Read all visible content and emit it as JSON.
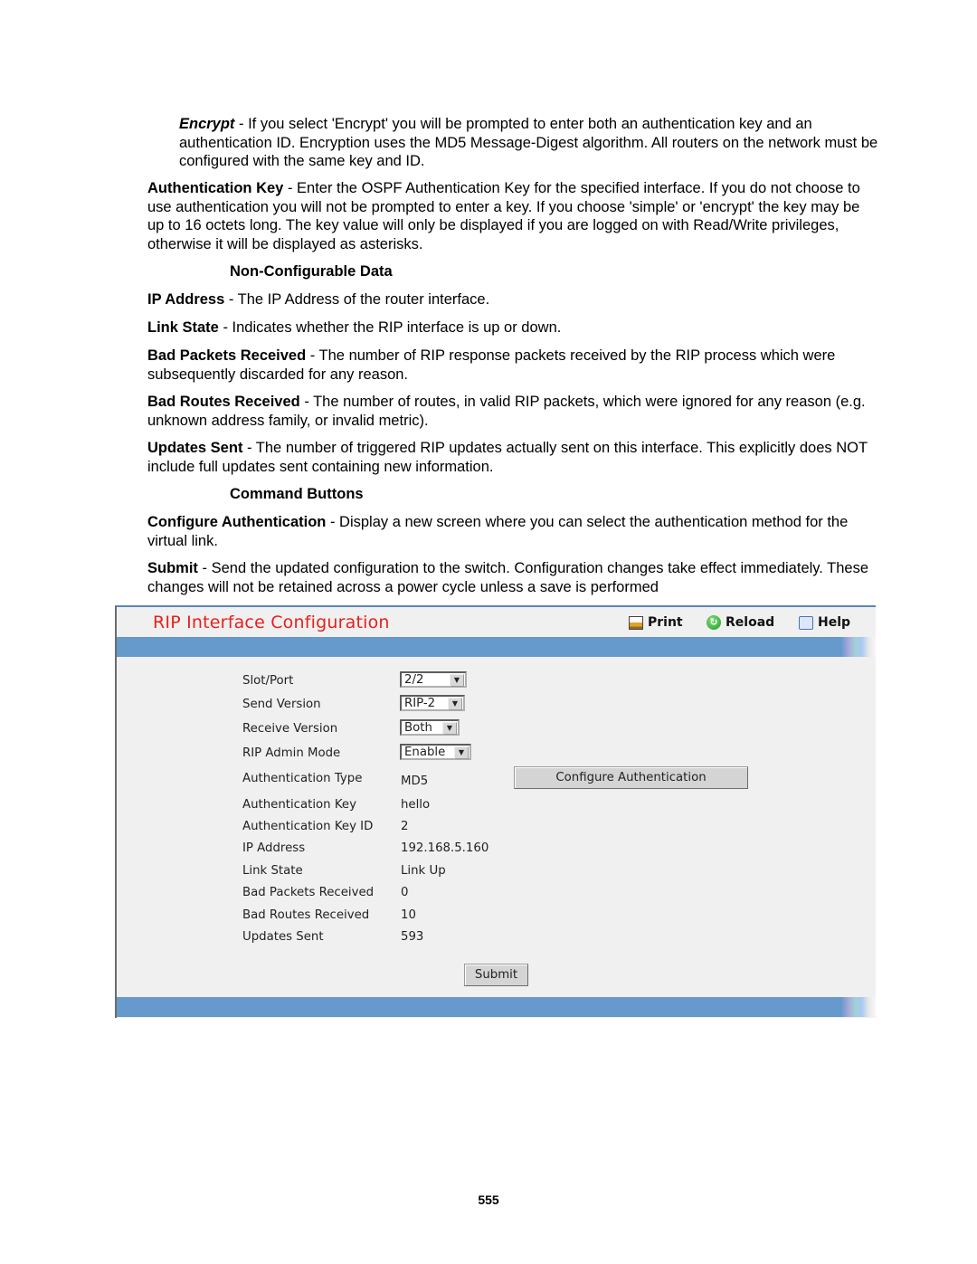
{
  "document": {
    "encrypt": {
      "term": "Encrypt",
      "text": " - If you select 'Encrypt' you will be prompted to enter both an authentication key and an authentication ID. Encryption uses the MD5 Message-Digest algorithm. All routers on the network must be configured with the same key and ID."
    },
    "auth_key": {
      "term": "Authentication Key",
      "text": " - Enter the OSPF Authentication Key for the specified interface. If you do not choose to use authentication you will not be prompted to enter a key. If you choose 'simple' or 'encrypt' the key may be up to 16 octets long. The key value will only be displayed if you are logged on with Read/Write privileges, otherwise it will be displayed as asterisks."
    },
    "non_config_heading": "Non-Configurable Data",
    "ip_address": {
      "term": "IP Address",
      "text": " - The IP Address of the router interface."
    },
    "link_state": {
      "term": "Link State",
      "text": " - Indicates whether the RIP interface is up or down."
    },
    "bad_packets": {
      "term": "Bad Packets Received",
      "text": " - The number of RIP response packets received by the RIP process which were subsequently discarded for any reason."
    },
    "bad_routes": {
      "term": "Bad Routes Received",
      "text": " - The number of routes, in valid RIP packets, which were ignored for any reason (e.g. unknown address family, or invalid metric)."
    },
    "updates_sent": {
      "term": "Updates Sent",
      "text": " - The number of triggered RIP updates actually sent on this interface. This explicitly does NOT include full updates sent containing new information."
    },
    "command_heading": "Command Buttons",
    "configure_auth": {
      "term": "Configure Authentication",
      "text": " - Display a new screen where you can select the authentication method for the virtual link."
    },
    "submit": {
      "term": "Submit",
      "text": " - Send the updated configuration to the switch. Configuration changes take effect immediately. These changes will not be retained across a power cycle unless a save is performed"
    },
    "page_number": "555"
  },
  "screenshot": {
    "title": "RIP Interface Configuration",
    "toolbar": {
      "print": "Print",
      "reload": "Reload",
      "help": "Help"
    },
    "fields": {
      "slot_port": {
        "label": "Slot/Port",
        "value": "2/2"
      },
      "send_version": {
        "label": "Send Version",
        "value": "RIP-2"
      },
      "receive_version": {
        "label": "Receive Version",
        "value": "Both"
      },
      "admin_mode": {
        "label": "RIP Admin Mode",
        "value": "Enable"
      },
      "auth_type": {
        "label": "Authentication Type",
        "value": "MD5"
      },
      "auth_key": {
        "label": "Authentication Key",
        "value": "hello"
      },
      "auth_key_id": {
        "label": "Authentication Key ID",
        "value": "2"
      },
      "ip_address": {
        "label": "IP Address",
        "value": "192.168.5.160"
      },
      "link_state": {
        "label": "Link State",
        "value": "Link Up"
      },
      "bad_packets": {
        "label": "Bad Packets Received",
        "value": "0"
      },
      "bad_routes": {
        "label": "Bad Routes Received",
        "value": "10"
      },
      "updates_sent": {
        "label": "Updates Sent",
        "value": "593"
      }
    },
    "buttons": {
      "configure_auth": "Configure Authentication",
      "submit": "Submit"
    }
  }
}
